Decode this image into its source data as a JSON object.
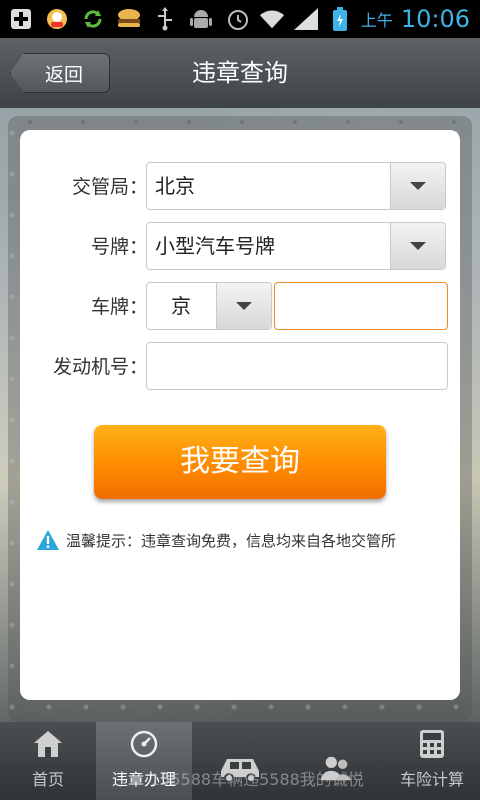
{
  "status_bar": {
    "ampm": "上午",
    "time": "10:06",
    "icons": [
      "add-icon",
      "avatar-icon",
      "sync-icon",
      "burger-icon",
      "usb-icon",
      "android-icon",
      "alarm-icon",
      "wifi-icon",
      "signal-icon",
      "battery-icon"
    ]
  },
  "header": {
    "back_label": "返回",
    "title": "违章查询"
  },
  "form": {
    "bureau_label": "交管局：",
    "bureau_value": "北京",
    "plate_type_label": "号牌：",
    "plate_type_value": "小型汽车号牌",
    "plate_label": "车牌：",
    "plate_prefix": "京",
    "plate_input_value": "",
    "engine_label": "发动机号：",
    "engine_value": ""
  },
  "query_button": "我要查询",
  "tip": "温馨提示：违章查询免费，信息均来自各地交管所",
  "nav": [
    {
      "label": "首页",
      "icon": "home-icon"
    },
    {
      "label": "违章办理",
      "icon": "speedometer-icon"
    },
    {
      "label": "",
      "icon": "car-icon"
    },
    {
      "label": "",
      "icon": "users-icon"
    },
    {
      "label": "车险计算",
      "icon": "calculator-icon"
    }
  ],
  "watermark": "155588车辆违5588我的诚悦",
  "colors": {
    "accent_orange": "#ff8a00",
    "status_blue": "#3fb3e6",
    "input_focus": "#f08a24"
  }
}
